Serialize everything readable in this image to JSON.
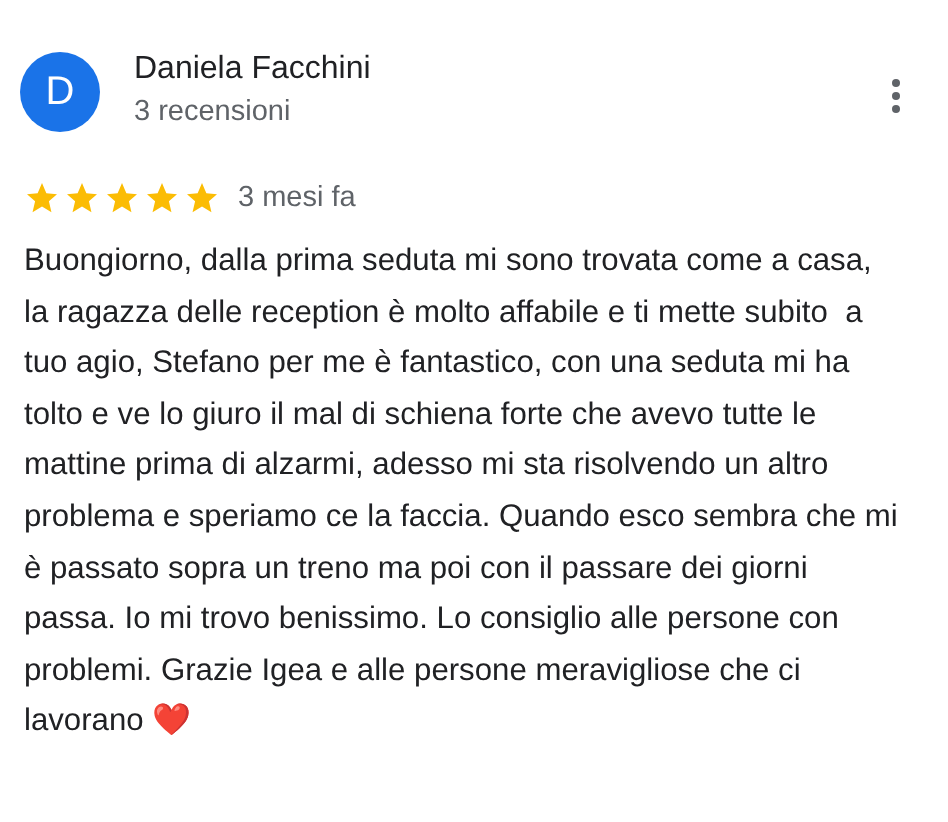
{
  "review": {
    "avatar_letter": "D",
    "author": "Daniela Facchini",
    "reviews_count": "3 recensioni",
    "stars": 5,
    "time": "3 mesi fa",
    "text": "Buongiorno, dalla prima seduta mi sono trovata come a casa, la ragazza delle reception è molto affabile e ti mette subito  a tuo agio, Stefano per me è fantastico, con una seduta mi ha tolto e ve lo giuro il mal di schiena forte che avevo tutte le mattine prima di alzarmi, adesso mi sta risolvendo un altro problema e speriamo ce la faccia. Quando esco sembra che mi è passato sopra un treno ma poi con il passare dei giorni passa. Io mi trovo benissimo. Lo consiglio alle persone con problemi. Grazie Igea e alle persone meravigliose che ci lavorano ❤️"
  }
}
